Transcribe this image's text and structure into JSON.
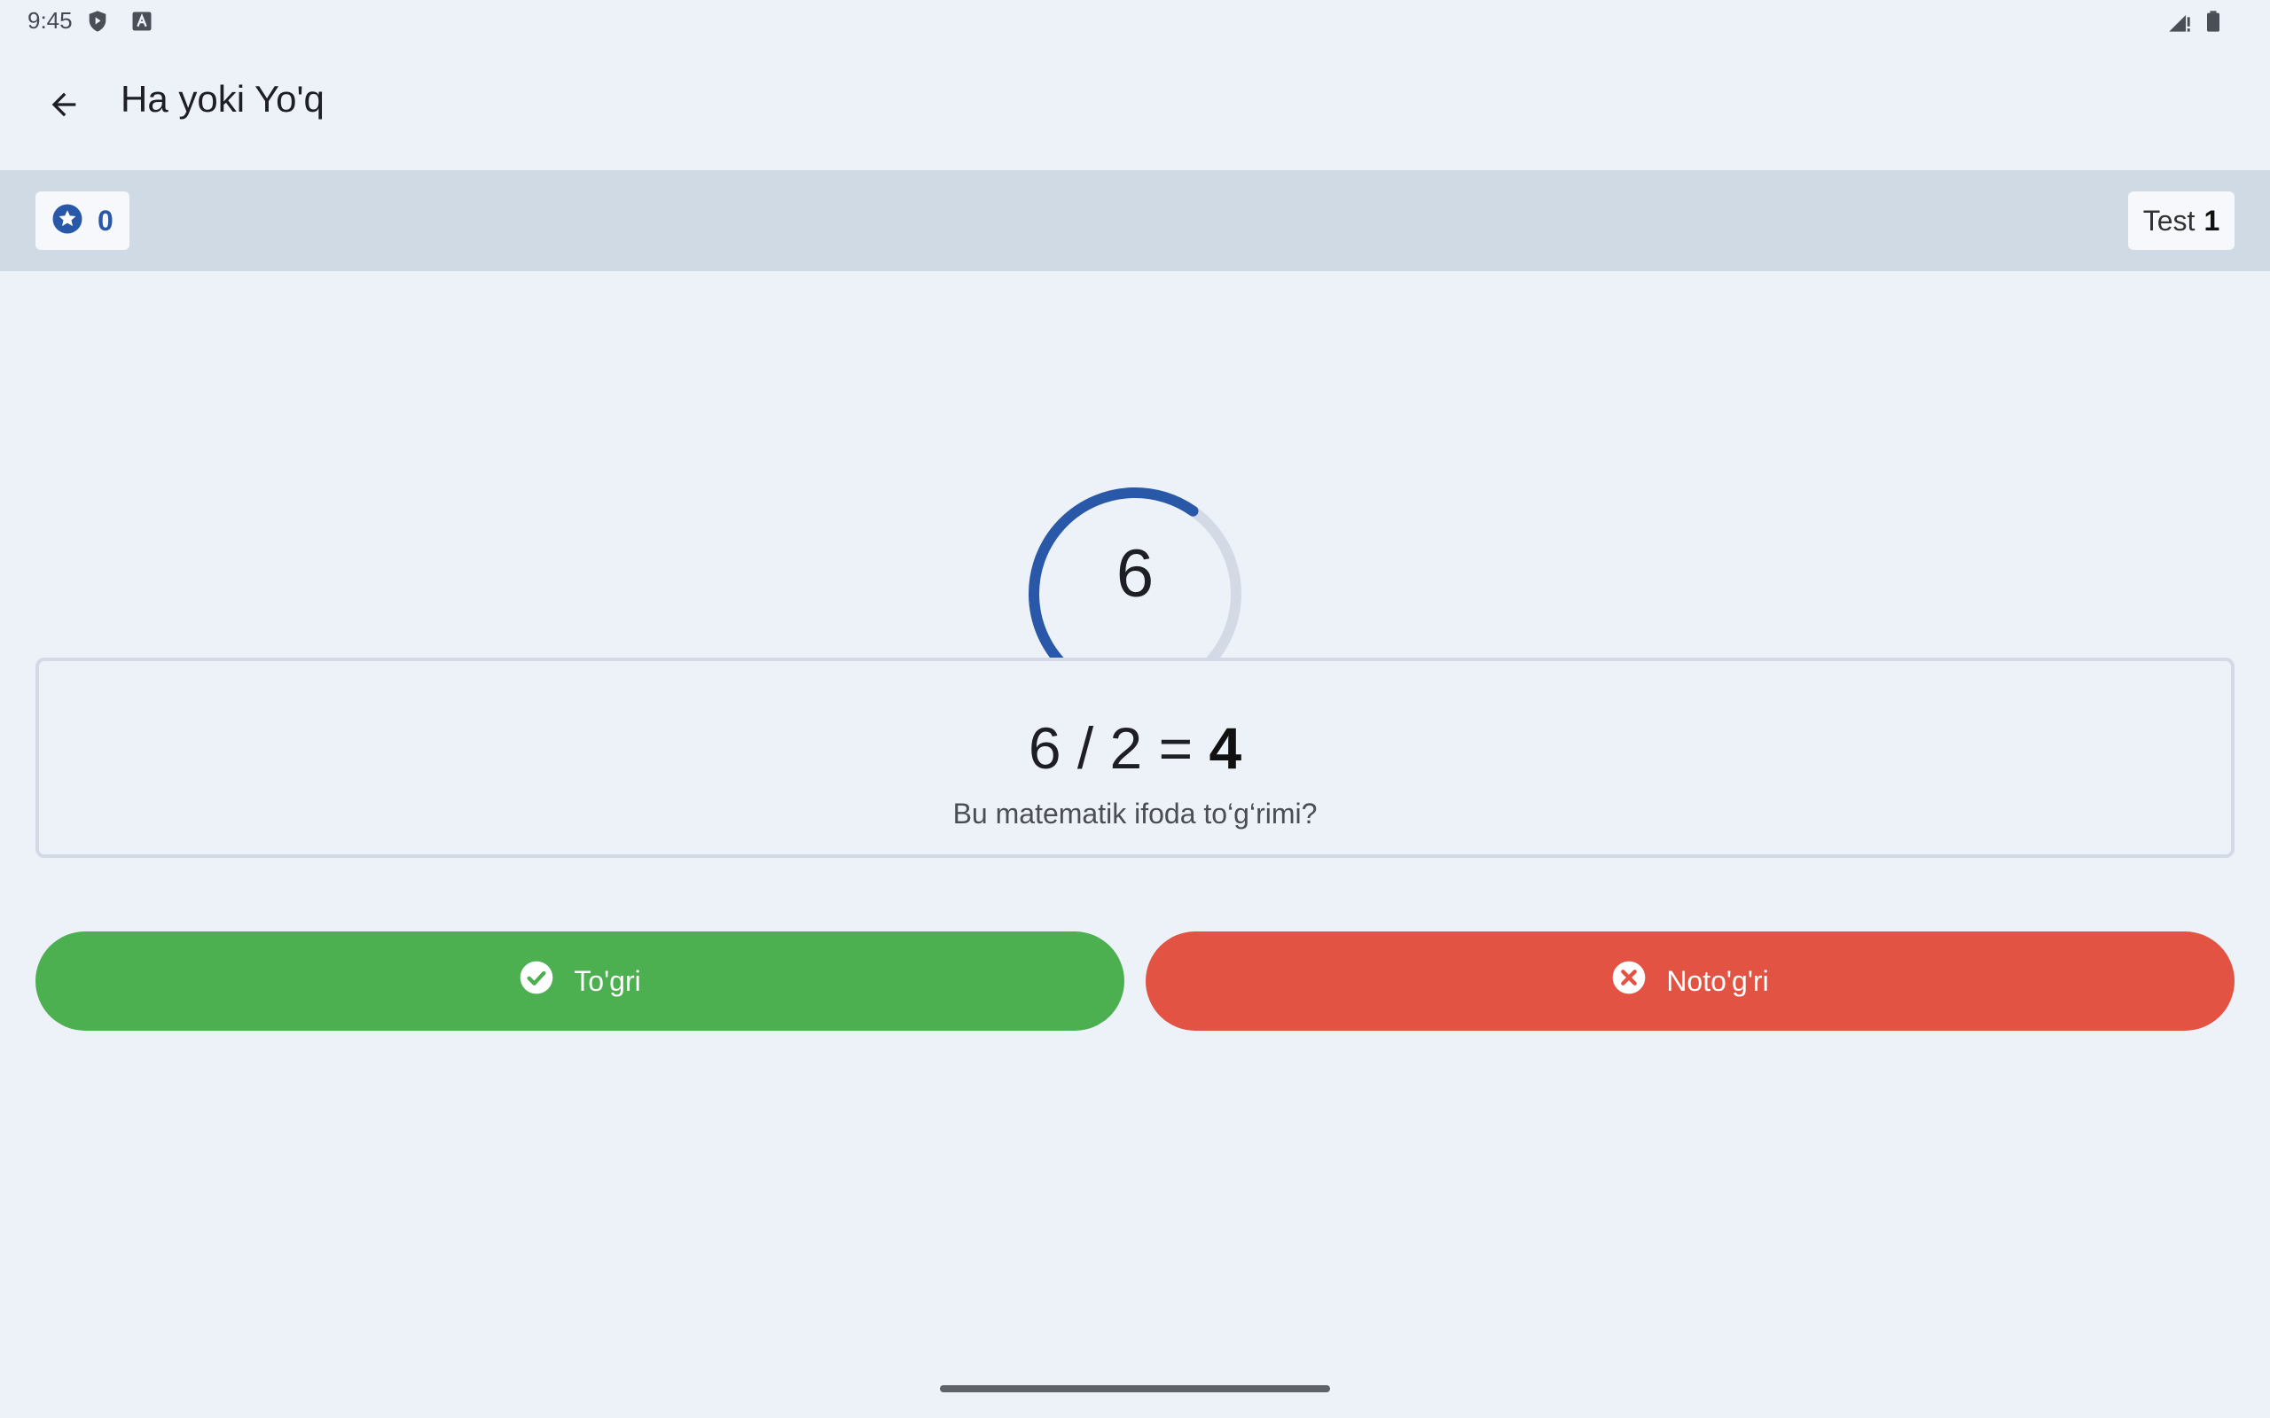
{
  "status": {
    "time": "9:45",
    "icons": [
      "shield-play-icon",
      "a-letter-icon",
      "signal-icon",
      "battery-icon"
    ]
  },
  "header": {
    "back_icon": "arrow-back-icon",
    "title": "Ha yoki Yo'q"
  },
  "score": {
    "icon": "star-circle-icon",
    "value": "0"
  },
  "test": {
    "label": "Test",
    "number": "1"
  },
  "timer": {
    "value": "6",
    "progress_fraction": 0.6
  },
  "question": {
    "expression": "6 / 2 =",
    "result": "4",
    "prompt": "Bu matematik ifoda to‘g‘rimi?"
  },
  "buttons": {
    "true_label": "To'gri",
    "false_label": "Noto'g'ri"
  },
  "colors": {
    "accent": "#2a58a8",
    "true": "#4caf50",
    "false": "#e25343",
    "track": "#d3dae6"
  }
}
